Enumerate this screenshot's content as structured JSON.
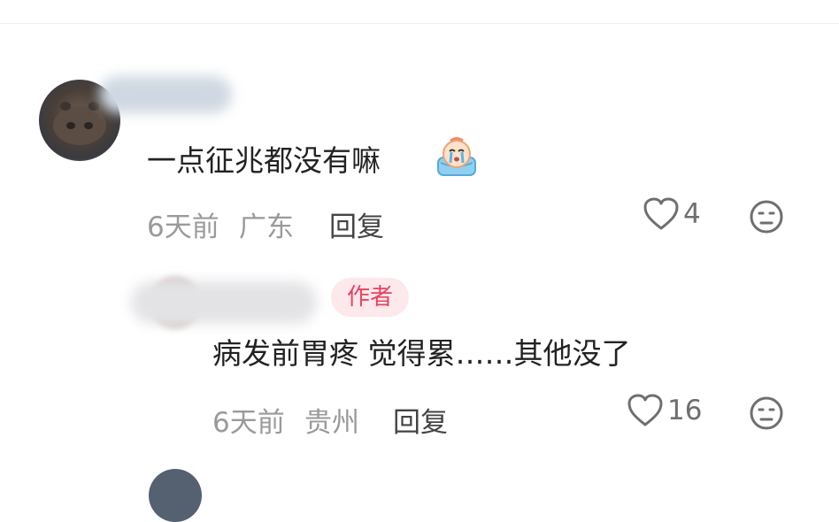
{
  "comment1": {
    "text": "一点征兆都没有嘛",
    "time": "6天前",
    "location": "广东",
    "reply_label": "回复",
    "like_count": "4"
  },
  "comment2": {
    "author_tag": "作者",
    "text": "病发前胃疼 觉得累……其他没了",
    "time": "6天前",
    "location": "贵州",
    "reply_label": "回复",
    "like_count": "16"
  },
  "icons": {
    "like": "heart-outline-icon",
    "dislike": "neutral-face-icon",
    "emoji": "crying-face-sticker"
  },
  "colors": {
    "author_tag_bg": "#fde8ec",
    "author_tag_text": "#e8435f",
    "meta_text": "#9a9a9a"
  }
}
